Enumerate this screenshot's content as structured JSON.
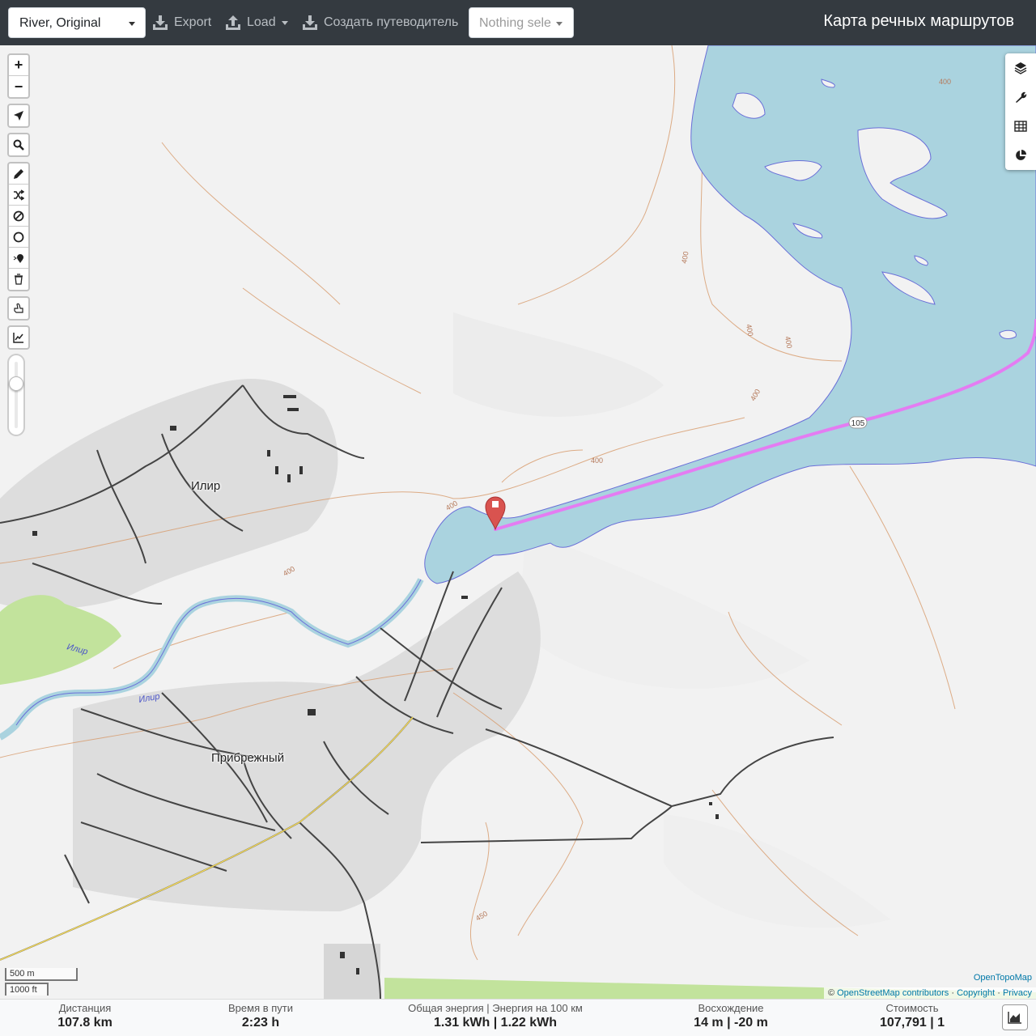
{
  "toolbar": {
    "profile_select": "River, Original",
    "export_label": "Export",
    "load_label": "Load",
    "guide_label": "Создать путеводитель",
    "nothing_selected": "Nothing sele",
    "app_title": "Карта речных маршрутов"
  },
  "map": {
    "places": [
      {
        "name": "Илир"
      },
      {
        "name": "Прибрежный"
      }
    ],
    "river_labels": [
      "Илир",
      "Илир"
    ],
    "contour_labels": [
      "400",
      "400",
      "400",
      "400",
      "400",
      "400",
      "400",
      "400",
      "450"
    ],
    "road_ref": "105",
    "scale": {
      "metric": "500 m",
      "imperial": "1000 ft"
    },
    "colors": {
      "water": "#aad3df",
      "route": "#e47cf2",
      "contour": "#d79a6a",
      "settlement": "#dcdcdc",
      "forest": "#c2e39c"
    }
  },
  "left_controls": {
    "zoom_in": "+",
    "zoom_out": "−",
    "icons": [
      "locate-icon",
      "search-icon",
      "draw-icon",
      "reroute-icon",
      "no-go-icon",
      "circle-icon",
      "poi-icon",
      "delete-icon",
      "hand-icon",
      "chart-icon"
    ]
  },
  "right_controls": {
    "icons": [
      "layers-icon",
      "wrench-icon",
      "table-icon",
      "pie-chart-icon"
    ]
  },
  "attribution": {
    "opentopomap": "OpenTopoMap",
    "copyright_sign": "©",
    "osm": "OpenStreetMap contributors",
    "sep1": " · ",
    "copyright": "Copyright",
    "sep2": " · ",
    "privacy": "Privacy"
  },
  "stats": {
    "distance": {
      "label": "Дистанция",
      "value": "107.8 km"
    },
    "time": {
      "label": "Время в пути",
      "value": "2:23 h"
    },
    "energy": {
      "label": "Общая энергия | Энергия на 100 км",
      "value": "1.31 kWh | 1.22 kWh"
    },
    "ascent": {
      "label": "Восхождение",
      "value": "14 m | -20 m"
    },
    "cost": {
      "label": "Стоимость",
      "value": "107,791 | 1"
    }
  }
}
